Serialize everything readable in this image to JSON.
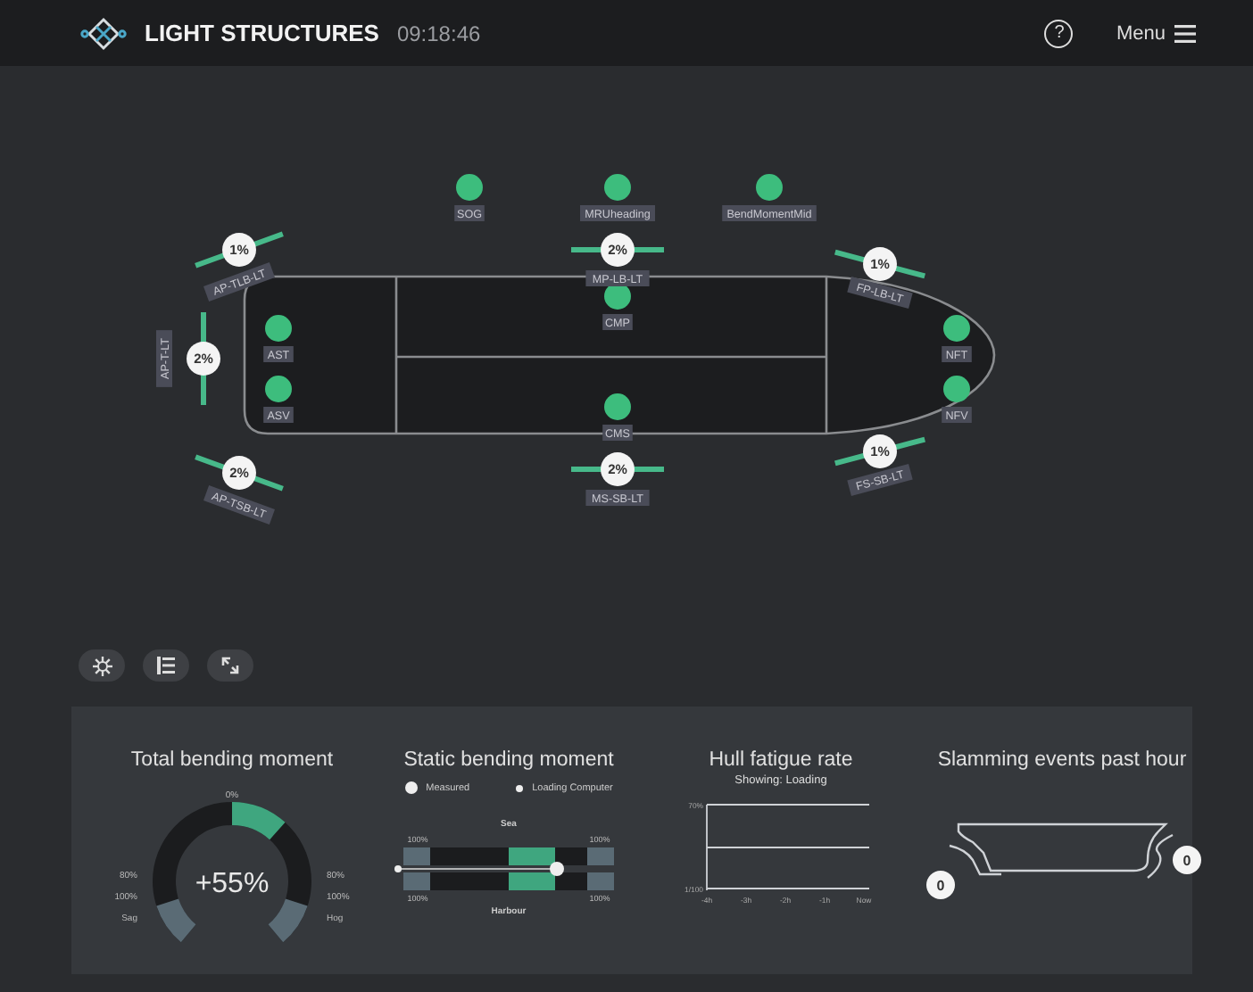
{
  "header": {
    "title": "LIGHT STRUCTURES",
    "time": "09:18:46",
    "help": "?",
    "menu": "Menu"
  },
  "sensors": [
    {
      "name": "SOG"
    },
    {
      "name": "MRUheading"
    },
    {
      "name": "BendMomentMid"
    },
    {
      "name": "CMP"
    },
    {
      "name": "CMS"
    },
    {
      "name": "AST"
    },
    {
      "name": "ASV"
    },
    {
      "name": "NFT"
    },
    {
      "name": "NFV"
    }
  ],
  "strain_gauges": [
    {
      "label": "AP-TLB-LT",
      "reading": "1%"
    },
    {
      "label": "AP-T-LT",
      "reading": "2%"
    },
    {
      "label": "AP-TSB-LT",
      "reading": "2%"
    },
    {
      "label": "MP-LB-LT",
      "reading": "2%"
    },
    {
      "label": "MS-SB-LT",
      "reading": "2%"
    },
    {
      "label": "FP-LB-LT",
      "reading": "1%"
    },
    {
      "label": "FS-SB-LT",
      "reading": "1%"
    }
  ],
  "toolbar": [
    {
      "kind": "settings"
    },
    {
      "kind": "list"
    },
    {
      "kind": "expand"
    }
  ],
  "panels": {
    "total_bending": {
      "title": "Total bending moment",
      "value": "+55%",
      "top_label": "0%",
      "left_labels": [
        "80%",
        "100%",
        "Sag"
      ],
      "right_labels": [
        "80%",
        "100%",
        "Hog"
      ]
    },
    "static_bending": {
      "title": "Static bending moment",
      "legend": [
        "Measured",
        "Loading Computer"
      ],
      "top_label": "Sea",
      "bottom_label": "Harbour",
      "limits": [
        "100%",
        "100%",
        "100%",
        "100%"
      ]
    },
    "fatigue": {
      "title": "Hull fatigue rate",
      "subtitle": "Showing: Loading",
      "y_labels": [
        "70%",
        "1/100"
      ],
      "x_labels": [
        "-4h",
        "-3h",
        "-2h",
        "-1h",
        "Now"
      ]
    },
    "slamming": {
      "title": "Slamming events past hour",
      "counts": [
        "0",
        "0"
      ]
    }
  }
}
